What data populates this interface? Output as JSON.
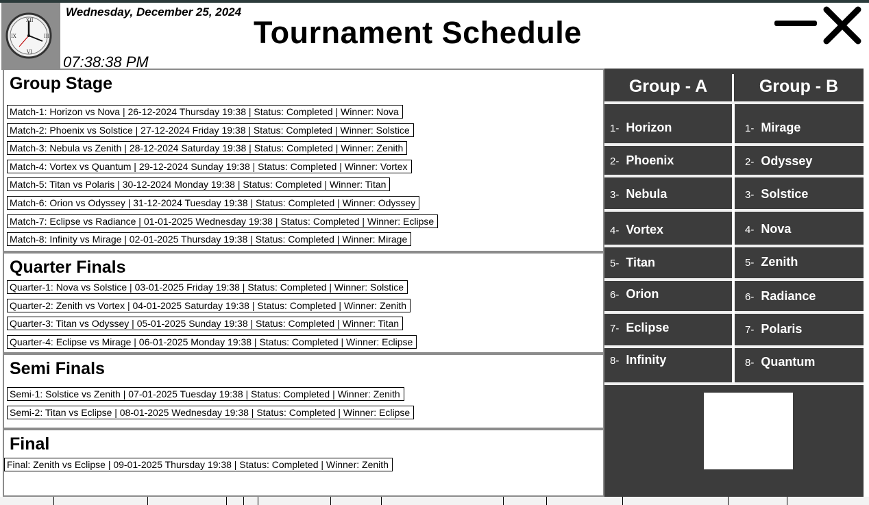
{
  "header": {
    "date": "Wednesday, December 25, 2024",
    "time": "07:38:38 PM",
    "title": "Tournament Schedule",
    "minimize_icon": "minus-icon",
    "close_icon": "close-x-icon"
  },
  "sections": {
    "group_stage": {
      "title": "Group Stage",
      "matches": [
        "Match-1: Horizon vs Nova | 26-12-2024 Thursday 19:38 | Status: Completed | Winner: Nova",
        "Match-2: Phoenix vs Solstice | 27-12-2024 Friday 19:38 | Status: Completed | Winner: Solstice",
        "Match-3: Nebula vs Zenith | 28-12-2024 Saturday 19:38 | Status: Completed | Winner: Zenith",
        "Match-4: Vortex vs Quantum | 29-12-2024 Sunday 19:38 | Status: Completed | Winner: Vortex",
        "Match-5: Titan vs Polaris | 30-12-2024 Monday 19:38 | Status: Completed | Winner: Titan",
        "Match-6: Orion vs Odyssey | 31-12-2024 Tuesday 19:38 | Status: Completed | Winner: Odyssey",
        "Match-7: Eclipse vs Radiance | 01-01-2025 Wednesday 19:38 | Status: Completed | Winner: Eclipse",
        "Match-8: Infinity vs Mirage | 02-01-2025 Thursday 19:38 | Status: Completed | Winner: Mirage"
      ]
    },
    "quarter_finals": {
      "title": "Quarter Finals",
      "matches": [
        "Quarter-1: Nova vs Solstice | 03-01-2025 Friday 19:38 | Status: Completed | Winner: Solstice",
        "Quarter-2: Zenith vs Vortex | 04-01-2025 Saturday 19:38 | Status: Completed | Winner: Zenith",
        "Quarter-3: Titan vs Odyssey | 05-01-2025 Sunday 19:38 | Status: Completed | Winner: Titan",
        "Quarter-4: Eclipse vs Mirage | 06-01-2025 Monday 19:38 | Status: Completed | Winner: Eclipse"
      ]
    },
    "semi_finals": {
      "title": "Semi Finals",
      "matches": [
        "Semi-1: Solstice vs Zenith | 07-01-2025 Tuesday 19:38 | Status: Completed | Winner: Zenith",
        "Semi-2: Titan vs Eclipse | 08-01-2025 Wednesday 19:38 | Status: Completed | Winner: Eclipse"
      ]
    },
    "final": {
      "title": "Final",
      "matches": [
        "Final: Zenith vs Eclipse | 09-01-2025 Thursday 19:38 | Status: Completed | Winner: Zenith"
      ]
    }
  },
  "groups": {
    "group_a": {
      "title": "Group - A",
      "teams": [
        {
          "num": "1-",
          "name": "Horizon"
        },
        {
          "num": "2-",
          "name": "Phoenix"
        },
        {
          "num": "3-",
          "name": "Nebula"
        },
        {
          "num": "4-",
          "name": "Vortex"
        },
        {
          "num": "5-",
          "name": "Titan"
        },
        {
          "num": "6-",
          "name": "Orion"
        },
        {
          "num": "7-",
          "name": "Eclipse"
        },
        {
          "num": "8-",
          "name": "Infinity"
        }
      ]
    },
    "group_b": {
      "title": "Group - B",
      "teams": [
        {
          "num": "1-",
          "name": "Mirage"
        },
        {
          "num": "2-",
          "name": "Odyssey"
        },
        {
          "num": "3-",
          "name": "Solstice"
        },
        {
          "num": "4-",
          "name": "Nova"
        },
        {
          "num": "5-",
          "name": "Zenith"
        },
        {
          "num": "6-",
          "name": "Radiance"
        },
        {
          "num": "7-",
          "name": "Polaris"
        },
        {
          "num": "8-",
          "name": "Quantum"
        }
      ]
    }
  },
  "colors": {
    "panel_bg": "#3c3c3c",
    "panel_text": "#ffffff",
    "title_bar": "#2b3a3a",
    "section_border": "#8c8c8c"
  }
}
